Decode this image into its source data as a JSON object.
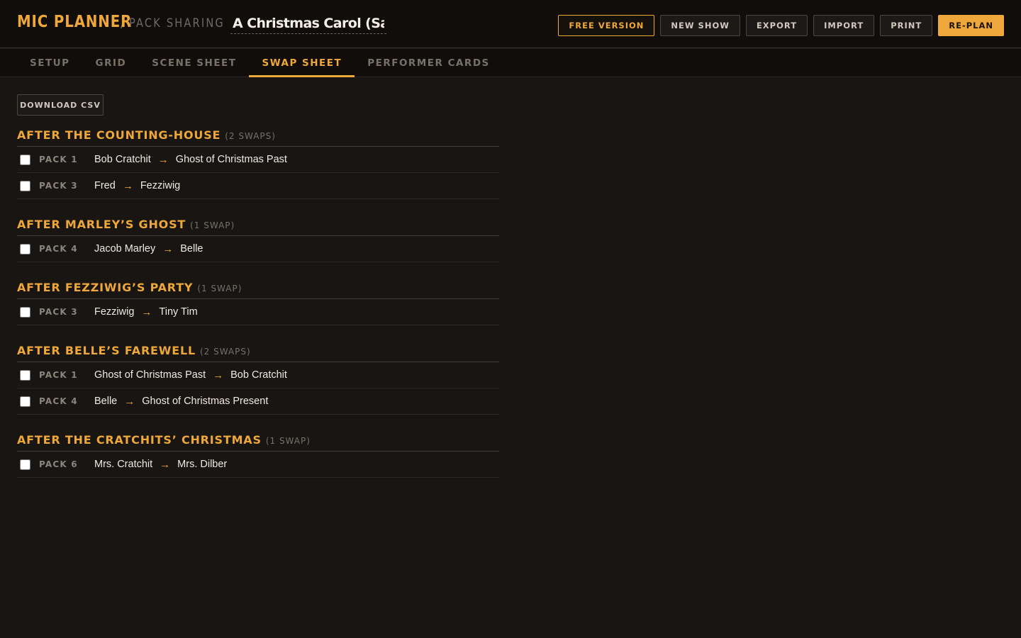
{
  "app": {
    "brand": "MIC PLANNER",
    "separator": "/",
    "subtitle": "PACK SHARING",
    "show_title": "A Christmas Carol (Sample)"
  },
  "toolbar": {
    "free_version": "FREE VERSION",
    "new_show": "NEW SHOW",
    "export": "EXPORT",
    "import": "IMPORT",
    "print": "PRINT",
    "replan": "RE-PLAN"
  },
  "tabs": [
    {
      "label": "SETUP",
      "active": false
    },
    {
      "label": "GRID",
      "active": false
    },
    {
      "label": "SCENE SHEET",
      "active": false
    },
    {
      "label": "SWAP SHEET",
      "active": true
    },
    {
      "label": "PERFORMER CARDS",
      "active": false
    }
  ],
  "swap_sheet": {
    "download_label": "DOWNLOAD CSV",
    "groups": [
      {
        "title": "AFTER THE COUNTING-HOUSE",
        "count": "(2 SWAPS)",
        "swaps": [
          {
            "pack": "PACK 1",
            "from": "Bob Cratchit",
            "to": "Ghost of Christmas Past",
            "checked": false
          },
          {
            "pack": "PACK 3",
            "from": "Fred",
            "to": "Fezziwig",
            "checked": false
          }
        ]
      },
      {
        "title": "AFTER MARLEY’S GHOST",
        "count": "(1 SWAP)",
        "swaps": [
          {
            "pack": "PACK 4",
            "from": "Jacob Marley",
            "to": "Belle",
            "checked": false
          }
        ]
      },
      {
        "title": "AFTER FEZZIWIG’S PARTY",
        "count": "(1 SWAP)",
        "swaps": [
          {
            "pack": "PACK 3",
            "from": "Fezziwig",
            "to": "Tiny Tim",
            "checked": false
          }
        ]
      },
      {
        "title": "AFTER BELLE’S FAREWELL",
        "count": "(2 SWAPS)",
        "swaps": [
          {
            "pack": "PACK 1",
            "from": "Ghost of Christmas Past",
            "to": "Bob Cratchit",
            "checked": false
          },
          {
            "pack": "PACK 4",
            "from": "Belle",
            "to": "Ghost of Christmas Present",
            "checked": false
          }
        ]
      },
      {
        "title": "AFTER THE CRATCHITS’ CHRISTMAS",
        "count": "(1 SWAP)",
        "swaps": [
          {
            "pack": "PACK 6",
            "from": "Mrs. Cratchit",
            "to": "Mrs. Dilber",
            "checked": false
          }
        ]
      }
    ]
  },
  "icons": {
    "arrow": "→"
  },
  "colors": {
    "accent": "#eea73a",
    "background": "#181512",
    "header": "#100d0b"
  }
}
